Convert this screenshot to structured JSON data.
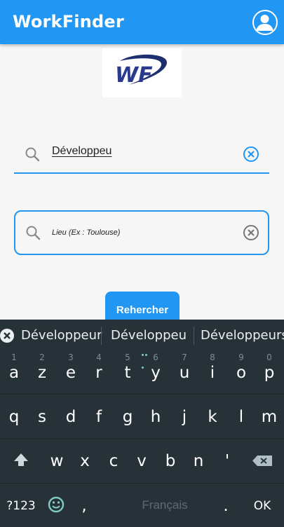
{
  "app": {
    "title": "WorkFinder",
    "logo_text": "WF"
  },
  "icons": {
    "account": "account-circle-icon",
    "search": "search-icon",
    "clear": "clear-circle-icon"
  },
  "search": {
    "job_value": "Développeu",
    "location_placeholder": "Lieu (Ex : Toulouse)",
    "button_label": "Rehercher"
  },
  "colors": {
    "primary": "#2196f3",
    "keyboard_bg": "#263238",
    "accent_dots": "#80cbc4"
  },
  "keyboard": {
    "suggestions": [
      "Développeur",
      "Développeu",
      "Développeurs"
    ],
    "row1": [
      {
        "ch": "a",
        "num": "1"
      },
      {
        "ch": "z",
        "num": "2"
      },
      {
        "ch": "e",
        "num": "3"
      },
      {
        "ch": "r",
        "num": "4"
      },
      {
        "ch": "t",
        "num": "5"
      },
      {
        "ch": "y",
        "num": "6"
      },
      {
        "ch": "u",
        "num": "7"
      },
      {
        "ch": "i",
        "num": "8"
      },
      {
        "ch": "o",
        "num": "9"
      },
      {
        "ch": "p",
        "num": "0"
      }
    ],
    "row2": [
      "q",
      "s",
      "d",
      "f",
      "g",
      "h",
      "j",
      "k",
      "l",
      "m"
    ],
    "row3": [
      "w",
      "x",
      "c",
      "v",
      "b",
      "n",
      "'"
    ],
    "symbols_label": "?123",
    "comma": ",",
    "space_label": "Français",
    "period": ".",
    "ok_label": "OK"
  }
}
